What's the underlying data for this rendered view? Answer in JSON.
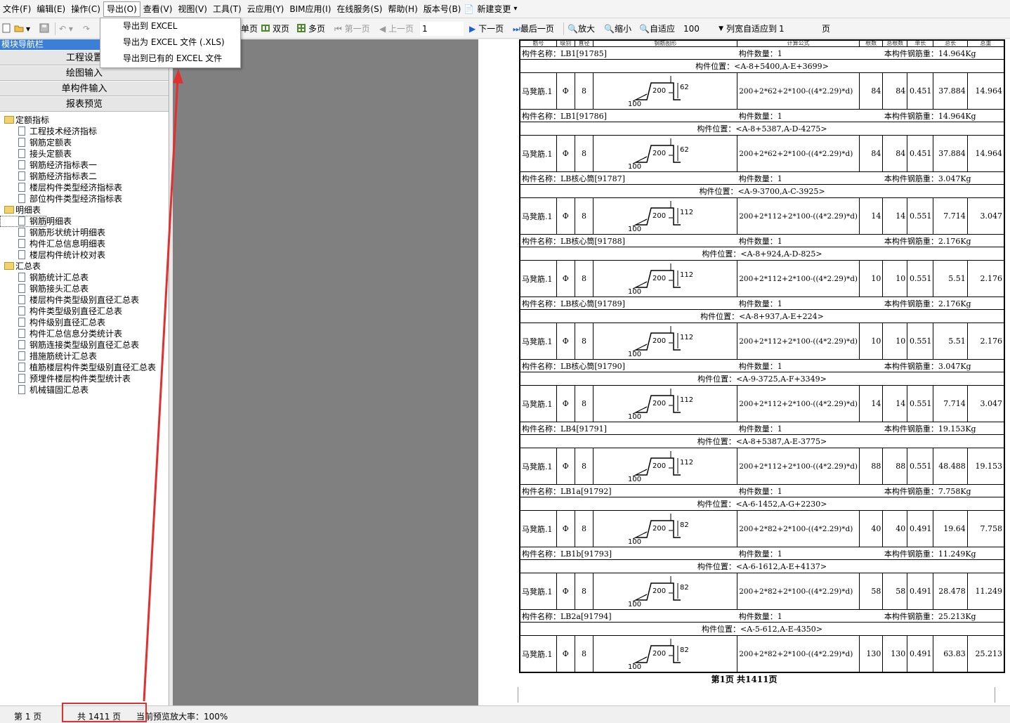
{
  "menu": [
    "文件(F)",
    "编辑(E)",
    "操作(C)",
    "导出(O)",
    "查看(V)",
    "视图(V)",
    "工具(T)",
    "云应用(Y)",
    "BIM应用(I)",
    "在线服务(S)",
    "帮助(H)",
    "版本号(B)",
    "新建变更"
  ],
  "export_menu": [
    "导出到 EXCEL",
    "导出为 EXCEL 文件 (.XLS)",
    "导出到已有的 EXCEL 文件"
  ],
  "toolbar": {
    "single_page": "单页",
    "double_page": "双页",
    "multi_page": "多页",
    "first_page": "第一页",
    "prev_page": "上一页",
    "page_input": "1",
    "next_page": "下一页",
    "last_page": "最后一页",
    "zoom_in": "放大",
    "zoom_out": "缩小",
    "fit": "自适应",
    "zoom_value": "100",
    "col_fit": "列宽自适应到",
    "col_fit_value": "1",
    "page_unit": "页"
  },
  "nav": {
    "title": "模块导航栏",
    "buttons": [
      "工程设置",
      "绘图输入",
      "单构件输入",
      "报表预览"
    ],
    "folders": [
      {
        "label": "定额指标",
        "items": [
          "工程技术经济指标",
          "钢筋定额表",
          "接头定额表",
          "钢筋经济指标表一",
          "钢筋经济指标表二",
          "楼层构件类型经济指标表",
          "部位构件类型经济指标表"
        ]
      },
      {
        "label": "明细表",
        "items": [
          "钢筋明细表",
          "钢筋形状统计明细表",
          "构件汇总信息明细表",
          "楼层构件统计校对表"
        ]
      },
      {
        "label": "汇总表",
        "items": [
          "钢筋统计汇总表",
          "钢筋接头汇总表",
          "楼层构件类型级别直径汇总表",
          "构件类型级别直径汇总表",
          "构件级别直径汇总表",
          "构件汇总信息分类统计表",
          "钢筋连接类型级别直径汇总表",
          "措施筋统计汇总表",
          "植筋楼层构件类型级别直径汇总表",
          "预埋件楼层构件类型统计表",
          "机械锚固汇总表"
        ]
      }
    ]
  },
  "report": {
    "header_cells": [
      "筋号",
      "级别",
      "直径",
      "钢筋图形",
      "计算公式",
      "根数",
      "总根数",
      "单长",
      "总长",
      "总重"
    ],
    "labels": {
      "name": "构件名称：",
      "count": "构件数量：",
      "weight": "本构件钢筋重：",
      "position": "构件位置："
    },
    "first_info": {
      "name": "LB1[91785]",
      "count": "1",
      "weight": "14.964Kg"
    },
    "blocks": [
      {
        "position": "<A-8+5400,A-E+3699>",
        "bar": "马凳筋.1",
        "grade": "Φ",
        "dia": "8",
        "dim_a": "200",
        "dim_b": "62",
        "dim_c": "100",
        "formula": "200+2*62+2*100-((4*2.29)*d)",
        "n": "84",
        "total_n": "84",
        "unit_len": "0.451",
        "total_len": "37.884",
        "weight": "14.964",
        "next": {
          "name": "LB1[91786]",
          "count": "1",
          "weight": "14.964Kg"
        }
      },
      {
        "position": "<A-8+5387,A-D-4275>",
        "bar": "马凳筋.1",
        "grade": "Φ",
        "dia": "8",
        "dim_a": "200",
        "dim_b": "62",
        "dim_c": "100",
        "formula": "200+2*62+2*100-((4*2.29)*d)",
        "n": "84",
        "total_n": "84",
        "unit_len": "0.451",
        "total_len": "37.884",
        "weight": "14.964",
        "next": {
          "name": "LB核心筒[91787]",
          "count": "1",
          "weight": "3.047Kg"
        }
      },
      {
        "position": "<A-9-3700,A-C-3925>",
        "bar": "马凳筋.1",
        "grade": "Φ",
        "dia": "8",
        "dim_a": "200",
        "dim_b": "112",
        "dim_c": "100",
        "formula": "200+2*112+2*100-((4*2.29)*d)",
        "n": "14",
        "total_n": "14",
        "unit_len": "0.551",
        "total_len": "7.714",
        "weight": "3.047",
        "next": {
          "name": "LB核心筒[91788]",
          "count": "1",
          "weight": "2.176Kg"
        }
      },
      {
        "position": "<A-8+924,A-D-825>",
        "bar": "马凳筋.1",
        "grade": "Φ",
        "dia": "8",
        "dim_a": "200",
        "dim_b": "112",
        "dim_c": "100",
        "formula": "200+2*112+2*100-((4*2.29)*d)",
        "n": "10",
        "total_n": "10",
        "unit_len": "0.551",
        "total_len": "5.51",
        "weight": "2.176",
        "next": {
          "name": "LB核心筒[91789]",
          "count": "1",
          "weight": "2.176Kg"
        }
      },
      {
        "position": "<A-8+937,A-E+224>",
        "bar": "马凳筋.1",
        "grade": "Φ",
        "dia": "8",
        "dim_a": "200",
        "dim_b": "112",
        "dim_c": "100",
        "formula": "200+2*112+2*100-((4*2.29)*d)",
        "n": "10",
        "total_n": "10",
        "unit_len": "0.551",
        "total_len": "5.51",
        "weight": "2.176",
        "next": {
          "name": "LB核心筒[91790]",
          "count": "1",
          "weight": "3.047Kg"
        }
      },
      {
        "position": "<A-9-3725,A-F+3349>",
        "bar": "马凳筋.1",
        "grade": "Φ",
        "dia": "8",
        "dim_a": "200",
        "dim_b": "112",
        "dim_c": "100",
        "formula": "200+2*112+2*100-((4*2.29)*d)",
        "n": "14",
        "total_n": "14",
        "unit_len": "0.551",
        "total_len": "7.714",
        "weight": "3.047",
        "next": {
          "name": "LB4[91791]",
          "count": "1",
          "weight": "19.153Kg"
        }
      },
      {
        "position": "<A-8+5387,A-E-3775>",
        "bar": "马凳筋.1",
        "grade": "Φ",
        "dia": "8",
        "dim_a": "200",
        "dim_b": "112",
        "dim_c": "100",
        "formula": "200+2*112+2*100-((4*2.29)*d)",
        "n": "88",
        "total_n": "88",
        "unit_len": "0.551",
        "total_len": "48.488",
        "weight": "19.153",
        "next": {
          "name": "LB1a[91792]",
          "count": "1",
          "weight": "7.758Kg"
        }
      },
      {
        "position": "<A-6-1452,A-G+2230>",
        "bar": "马凳筋.1",
        "grade": "Φ",
        "dia": "8",
        "dim_a": "200",
        "dim_b": "82",
        "dim_c": "100",
        "formula": "200+2*82+2*100-((4*2.29)*d)",
        "n": "40",
        "total_n": "40",
        "unit_len": "0.491",
        "total_len": "19.64",
        "weight": "7.758",
        "next": {
          "name": "LB1b[91793]",
          "count": "1",
          "weight": "11.249Kg"
        }
      },
      {
        "position": "<A-6-1612,A-E+4137>",
        "bar": "马凳筋.1",
        "grade": "Φ",
        "dia": "8",
        "dim_a": "200",
        "dim_b": "82",
        "dim_c": "100",
        "formula": "200+2*82+2*100-((4*2.29)*d)",
        "n": "58",
        "total_n": "58",
        "unit_len": "0.491",
        "total_len": "28.478",
        "weight": "11.249",
        "next": {
          "name": "LB2a[91794]",
          "count": "1",
          "weight": "25.213Kg"
        }
      },
      {
        "position": "<A-5-612,A-E-4350>",
        "bar": "马凳筋.1",
        "grade": "Φ",
        "dia": "8",
        "dim_a": "200",
        "dim_b": "82",
        "dim_c": "100",
        "formula": "200+2*82+2*100-((4*2.29)*d)",
        "n": "130",
        "total_n": "130",
        "unit_len": "0.491",
        "total_len": "63.83",
        "weight": "25.213",
        "next": null
      }
    ],
    "page_footer": "第1页  共1411页"
  },
  "status": {
    "page": "第  1 页",
    "total": "共 1411 页",
    "zoom": "当前预览放大率：100%"
  },
  "colors": {
    "highlight": "#e23030",
    "nav_title": "#3b7fd9",
    "canvas": "#808080"
  }
}
